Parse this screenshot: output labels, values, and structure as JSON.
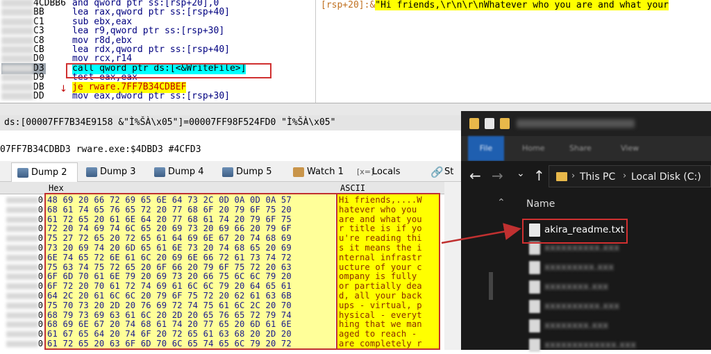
{
  "disassembly": {
    "rows": [
      {
        "addr_suffix": "4CDBB6",
        "instr": "and qword ptr ss:[rsp+20],0"
      },
      {
        "addr_suffix": "BB",
        "instr": "lea rax,qword ptr ss:[rsp+40]"
      },
      {
        "addr_suffix": "C1",
        "instr": "sub ebx,eax"
      },
      {
        "addr_suffix": "C3",
        "instr": "lea r9,qword ptr ss:[rsp+30]"
      },
      {
        "addr_suffix": "C8",
        "instr": "mov r8d,ebx"
      },
      {
        "addr_suffix": "CB",
        "instr": "lea rdx,qword ptr ss:[rsp+40]"
      },
      {
        "addr_suffix": "D0",
        "instr": "mov rcx,r14"
      },
      {
        "addr_suffix": "D3",
        "instr": "call qword ptr ds:[<&WriteFile>]"
      },
      {
        "addr_suffix": "D9",
        "instr": "test eax,eax"
      },
      {
        "addr_suffix": "DB",
        "instr": "je rware.7FF7B34CDBEF"
      },
      {
        "addr_suffix": "DD",
        "instr": "mov eax,dword ptr ss:[rsp+30]"
      }
    ],
    "comment_label": "[rsp+20]:&",
    "comment_string": "\"Hi friends,\\r\\n\\r\\nWhatever who you are and what your"
  },
  "info": {
    "line1": "ds:[00007FF7B34E9158 &\"Ì%ŠÀ\\x05\"]=00007FF98F524FD0 \"Ì%ŠÀ\\x05\"",
    "line2": "07FF7B34CDBD3 rware.exe:$4DBD3 #4CFD3"
  },
  "tabs": [
    {
      "label": "Dump 2",
      "icon": "dump-icon"
    },
    {
      "label": "Dump 3",
      "icon": "dump-icon"
    },
    {
      "label": "Dump 4",
      "icon": "dump-icon"
    },
    {
      "label": "Dump 5",
      "icon": "dump-icon"
    },
    {
      "label": "Watch 1",
      "icon": "watch-icon"
    },
    {
      "label": "Locals",
      "icon": "locals-icon"
    },
    {
      "label": "St",
      "icon": "stack-icon"
    }
  ],
  "dump": {
    "hex_header": "Hex",
    "ascii_header": "ASCII",
    "hex_rows": [
      "48 69 20 66 72 69 65 6E 64 73 2C 0D 0A 0D 0A 57",
      "68 61 74 65 76 65 72 20 77 68 6F 20 79 6F 75 20",
      "61 72 65 20 61 6E 64 20 77 68 61 74 20 79 6F 75",
      "72 20 74 69 74 6C 65 20 69 73 20 69 66 20 79 6F",
      "75 27 72 65 20 72 65 61 64 69 6E 67 20 74 68 69",
      "73 20 69 74 20 6D 65 61 6E 73 20 74 68 65 20 69",
      "6E 74 65 72 6E 61 6C 20 69 6E 66 72 61 73 74 72",
      "75 63 74 75 72 65 20 6F 66 20 79 6F 75 72 20 63",
      "6F 6D 70 61 6E 79 20 69 73 20 66 75 6C 6C 79 20",
      "6F 72 20 70 61 72 74 69 61 6C 6C 79 20 64 65 61",
      "64 2C 20 61 6C 6C 20 79 6F 75 72 20 62 61 63 6B",
      "75 70 73 20 2D 20 76 69 72 74 75 61 6C 2C 20 70",
      "68 79 73 69 63 61 6C 20 2D 20 65 76 65 72 79 74",
      "68 69 6E 67 20 74 68 61 74 20 77 65 20 6D 61 6E",
      "61 67 65 64 20 74 6F 20 72 65 61 63 68 20 2D 20",
      "61 72 65 20 63 6F 6D 70 6C 65 74 65 6C 79 20 72"
    ],
    "ascii_rows": [
      "Hi friends,....W",
      "hatever who you ",
      "are and what you",
      "r title is if yo",
      "u're reading thi",
      "s it means the i",
      "nternal infrastr",
      "ucture of your c",
      "ompany is fully ",
      "or partially dea",
      "d, all your back",
      "ups - virtual, p",
      "hysical - everyt",
      "hing that we man",
      "aged to reach - ",
      "are completely r"
    ]
  },
  "explorer": {
    "ribbon_tabs": [
      "File",
      "Home",
      "Share",
      "View"
    ],
    "nav": {
      "back": "←",
      "forward": "→",
      "expand": "⌄",
      "up": "↑"
    },
    "breadcrumb": [
      "This PC",
      "Local Disk (C:)"
    ],
    "column_header": "Name",
    "highlighted_file": "akira_readme.txt",
    "blurred_files": [
      "xxxxxxxxxx.xxx",
      "xxxxxxxxx.xxx",
      "xxxxxxxx.xxx",
      "xxxxxxxxxx.xxx",
      "xxxxxxxx.xxx",
      "xxxxxxxxxxxxx.xxx"
    ]
  },
  "colors": {
    "highlight_box": "#d03030",
    "dump_ascii_bg": "#ffff00",
    "explorer_bg": "#191919"
  }
}
